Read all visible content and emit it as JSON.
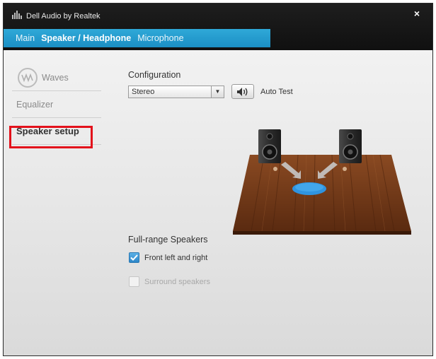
{
  "window": {
    "title": "Dell Audio by Realtek",
    "close_glyph": "×"
  },
  "tabs": [
    {
      "label": "Main",
      "active": false
    },
    {
      "label": "Speaker / Headphone",
      "active": true
    },
    {
      "label": "Microphone",
      "active": false
    }
  ],
  "sidebar": {
    "items": [
      {
        "label": "Waves",
        "icon": "waves-logo-icon"
      },
      {
        "label": "Equalizer"
      },
      {
        "label": "Speaker setup",
        "selected": true
      }
    ]
  },
  "configuration": {
    "label": "Configuration",
    "selected": "Stereo",
    "auto_test_label": "Auto Test"
  },
  "full_range": {
    "label": "Full-range Speakers",
    "options": [
      {
        "label": "Front left and right",
        "checked": true,
        "enabled": true
      },
      {
        "label": "Surround speakers",
        "checked": false,
        "enabled": false
      }
    ]
  },
  "colors": {
    "accent": "#1b8fc4",
    "highlight": "#e3111b",
    "floor": "#6b3516"
  }
}
